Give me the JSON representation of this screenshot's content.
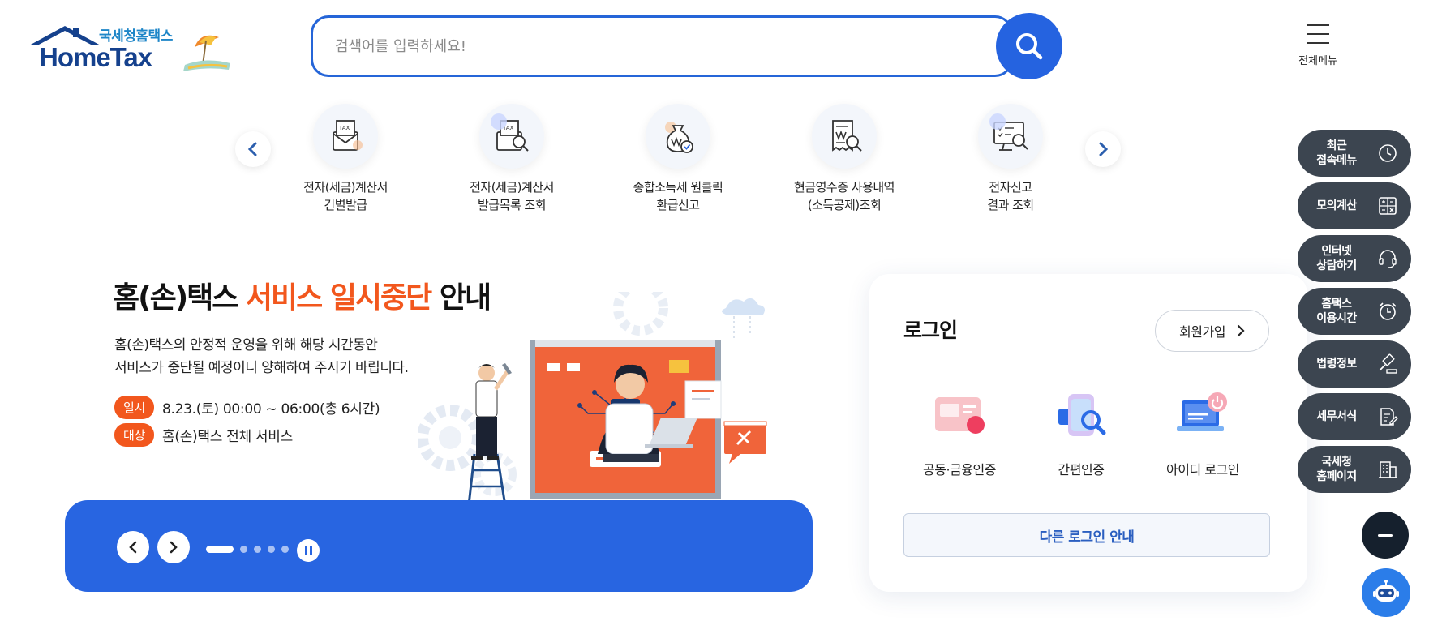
{
  "header": {
    "logo_kor": "국세청홈택스",
    "logo_eng": "HomeTax",
    "search_placeholder": "검색어를 입력하세요!",
    "all_menu_label": "전체메뉴"
  },
  "quick_menu": {
    "items": [
      {
        "line1": "전자(세금)계산서",
        "line2": "건별발급",
        "icon": "tax-envelope-icon"
      },
      {
        "line1": "전자(세금)계산서",
        "line2": "발급목록 조회",
        "icon": "tax-search-icon"
      },
      {
        "line1": "종합소득세 원클릭",
        "line2": "환급신고",
        "icon": "money-bag-icon"
      },
      {
        "line1": "현금영수증 사용내역",
        "line2": "(소득공제)조회",
        "icon": "receipt-search-icon"
      },
      {
        "line1": "전자신고",
        "line2": "결과 조회",
        "icon": "monitor-search-icon"
      }
    ]
  },
  "banner": {
    "title_pre": "홈(손)택스 ",
    "title_highlight": "서비스 일시중단",
    "title_post": " 안내",
    "desc_line1": "홈(손)택스의 안정적 운영을 위해 해당 시간동안",
    "desc_line2": "서비스가 중단될 예정이니 양해하여 주시기 바립니다.",
    "date_tag": "일시",
    "date_text": "8.23.(토) 00:00 ~ 06:00(총 6시간)",
    "target_tag": "대상",
    "target_text": "홈(손)택스 전체 서비스",
    "slide_count": 5,
    "active_slide": 1
  },
  "login": {
    "title": "로그인",
    "join_label": "회원가입",
    "options": [
      {
        "label": "공동·금융인증",
        "icon": "certificate-icon"
      },
      {
        "label": "간편인증",
        "icon": "simple-auth-icon"
      },
      {
        "label": "아이디 로그인",
        "icon": "id-login-icon"
      }
    ],
    "other_login_label": "다른 로그인 안내"
  },
  "side_menu": {
    "recent_line1": "최근",
    "recent_line2": "접속메뉴",
    "mock_calc": "모의계산",
    "consult_line1": "인터넷",
    "consult_line2": "상담하기",
    "hours_line1": "홈택스",
    "hours_line2": "이용시간",
    "law_info": "법령정보",
    "tax_forms": "세무서식",
    "nts_line1": "국세청",
    "nts_line2": "홈페이지"
  },
  "colors": {
    "primary": "#2563e0",
    "highlight": "#f2571d",
    "side_button": "#3c4550",
    "logo_navy": "#15418d"
  }
}
